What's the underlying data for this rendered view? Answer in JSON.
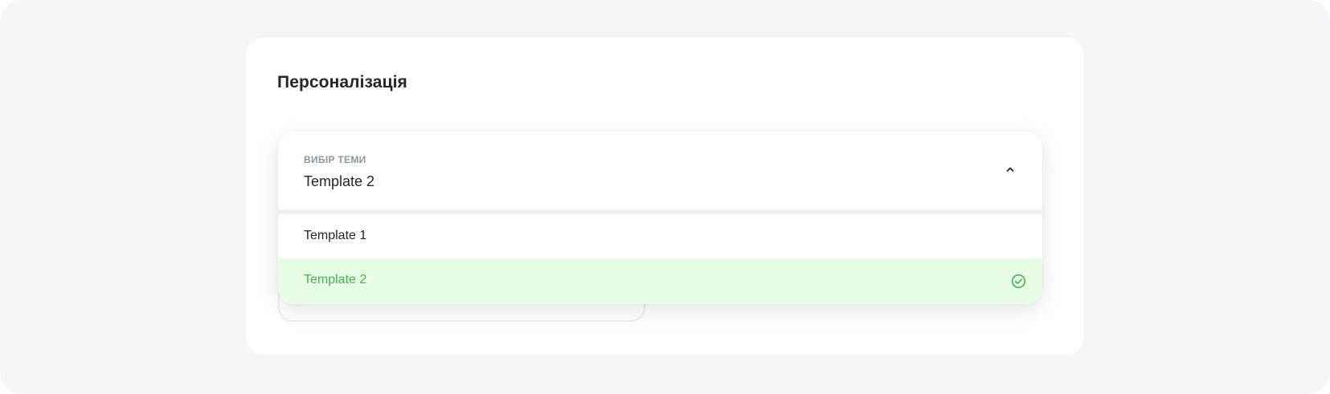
{
  "section": {
    "title": "Персоналізація"
  },
  "theme_select": {
    "label": "ВИБІР ТЕМИ",
    "value": "Template 2",
    "expanded": true,
    "chevron_icon": "chevron-up-icon",
    "options": [
      {
        "label": "Template 1",
        "selected": false
      },
      {
        "label": "Template 2",
        "selected": true,
        "icon": "check-circle-icon"
      }
    ]
  },
  "colors": {
    "page_background": "#f4f5f9",
    "card_background": "#ffffff",
    "selected_background": "#e8fde5",
    "selected_text": "#44b349",
    "label_text": "#8d93a0",
    "primary_text": "#22252b"
  }
}
